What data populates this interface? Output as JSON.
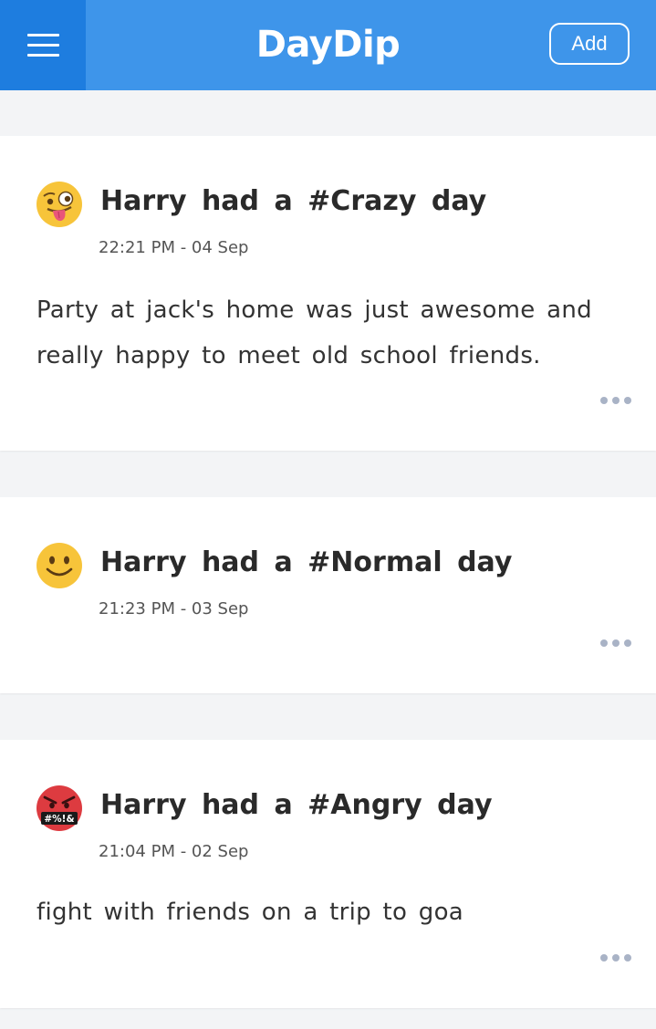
{
  "header": {
    "brand": "DayDip",
    "add_label": "Add",
    "color": "#3e95ea",
    "menu_color": "#1e7ddf"
  },
  "posts": [
    {
      "emoji": "crazy-face-icon",
      "user": "Harry",
      "connector": "had a",
      "mood": "#Crazy",
      "suffix": "day",
      "time": "22:21 PM - 04 Sep",
      "text": "Party at jack's home was just awesome and really happy to meet old school friends."
    },
    {
      "emoji": "smiling-face-icon",
      "user": "Harry",
      "connector": "had a",
      "mood": "#Normal",
      "suffix": "day",
      "time": "21:23 PM - 03 Sep",
      "text": ""
    },
    {
      "emoji": "angry-face-icon",
      "user": "Harry",
      "connector": "had a",
      "mood": "#Angry",
      "suffix": "day",
      "time": "21:04 PM - 02 Sep",
      "text": "fight with friends on a trip to goa",
      "emoji_text": "#%!&"
    }
  ]
}
